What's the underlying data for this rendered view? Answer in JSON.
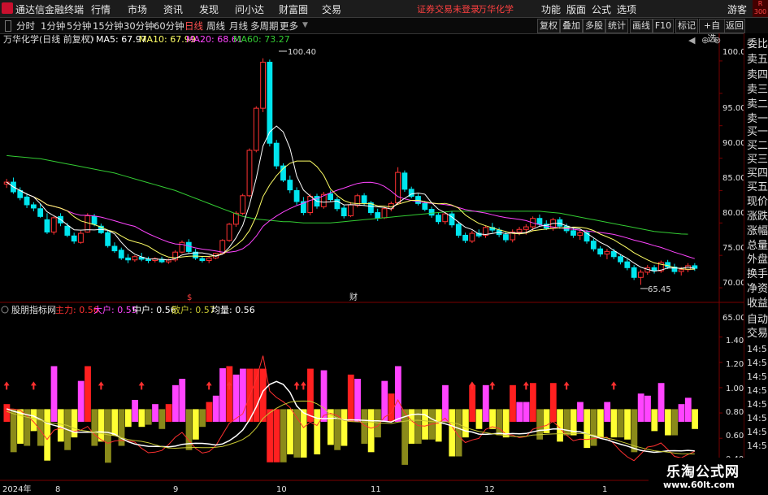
{
  "menubar": {
    "app_title": "通达信金融终端",
    "items": [
      "行情",
      "市场",
      "资讯",
      "发现",
      "问小达",
      "财富圈",
      "交易"
    ],
    "status": "证券交易未登录",
    "stock": "万华化学",
    "right_items": [
      "功能",
      "版面",
      "公式",
      "选项"
    ],
    "guest": "游客"
  },
  "toolbar": {
    "periods": [
      "分时",
      "1分钟",
      "5分钟",
      "15分钟",
      "30分钟",
      "60分钟",
      "日线",
      "周线",
      "月线",
      "多周期",
      "更多"
    ],
    "active": "日线",
    "buttons": [
      "复权",
      "叠加",
      "多股",
      "统计",
      "画线",
      "F10",
      "标记",
      "+自选",
      "返回"
    ]
  },
  "main": {
    "title": "万华化学(日线 前复权)",
    "ma_labels": [
      {
        "text": "MA5: 67.97",
        "color": "#ffffff"
      },
      {
        "text": "MA10: 67.99",
        "color": "#ffff66"
      },
      {
        "text": "MA20: 68.61",
        "color": "#ff44ff"
      },
      {
        "text": "MA60: 73.27",
        "color": "#33cc33"
      }
    ],
    "high_label": "100.40",
    "low_label": "65.45",
    "y_ticks": [
      "100.0",
      "95.00",
      "90.00",
      "85.00",
      "80.00",
      "75.00",
      "70.00",
      "65.00"
    ],
    "markers": [
      "$",
      "财"
    ]
  },
  "sub": {
    "title": "股朋指标网",
    "labels": [
      {
        "text": "主力: 0.56",
        "color": "#ff3030"
      },
      {
        "text": "大户: 0.55",
        "color": "#ff44ff"
      },
      {
        "text": "中户: 0.56",
        "color": "#ffffff"
      },
      {
        "text": "散户: 0.57",
        "color": "#c8c832"
      },
      {
        "text": "均量: 0.56",
        "color": "#ffffff"
      }
    ],
    "y_ticks": [
      "1.40",
      "1.20",
      "1.00",
      "0.80",
      "0.60",
      "0.40"
    ]
  },
  "x_axis": [
    "2024年",
    "8",
    "9",
    "10",
    "11",
    "12",
    "1"
  ],
  "right_panel": [
    "委比",
    "卖五",
    "卖四",
    "卖三",
    "卖二",
    "卖一",
    "买一",
    "买二",
    "买三",
    "买四",
    "买五",
    "现价",
    "涨跌",
    "涨幅",
    "总量",
    "外盘",
    "换手",
    "净资",
    "收益",
    "",
    "自动",
    "交易",
    "14:5",
    "14:5",
    "14:5",
    "14:5",
    "14:5",
    "14:5",
    "14:5",
    "14:5"
  ],
  "watermark": {
    "line1": "乐淘公式网",
    "line2": "www.60lt.com"
  },
  "colors": {
    "up": "#ff3232",
    "down": "#00e5ee",
    "ma5": "#ffffff",
    "ma10": "#ffff66",
    "ma20": "#ff44ff",
    "ma60": "#33cc33",
    "axis": "#7a0000"
  },
  "chart_data": {
    "type": "candlestick",
    "price_ylim": [
      63.5,
      102.5
    ],
    "sub_ylim": [
      0.28,
      1.52
    ],
    "candles": [
      [
        81,
        81.8,
        80.4,
        81.3
      ],
      [
        81.3,
        82,
        79.5,
        79.8
      ],
      [
        80,
        80.5,
        78.5,
        78.9
      ],
      [
        79,
        79.6,
        77.3,
        77.8
      ],
      [
        77.8,
        78.2,
        76.8,
        77.3
      ],
      [
        77.2,
        78,
        75.8,
        76
      ],
      [
        75.5,
        76.5,
        73.3,
        73.6
      ],
      [
        73.6,
        76,
        73.2,
        75.8
      ],
      [
        76,
        76.5,
        74.5,
        75
      ],
      [
        74.5,
        75,
        72.8,
        73.1
      ],
      [
        73,
        73.5,
        71.8,
        72.2
      ],
      [
        72,
        73.8,
        71.8,
        73.4
      ],
      [
        73.6,
        76.5,
        73.5,
        76.1
      ],
      [
        76,
        76.4,
        74.5,
        74.8
      ],
      [
        74.5,
        74.9,
        73.3,
        73.5
      ],
      [
        73.5,
        73.8,
        71.2,
        71.5
      ],
      [
        71.4,
        72,
        70.4,
        70.7
      ],
      [
        70.8,
        71.2,
        69.3,
        69.6
      ],
      [
        69.6,
        70.2,
        68.8,
        69.3
      ],
      [
        69.3,
        70,
        69,
        69.8
      ],
      [
        69.7,
        70.4,
        69.1,
        69.4
      ],
      [
        69.4,
        69.8,
        68.8,
        69.2
      ],
      [
        69.2,
        69.7,
        68.9,
        69.5
      ],
      [
        69.4,
        69.8,
        68.8,
        69
      ],
      [
        69,
        69.5,
        68.7,
        69.3
      ],
      [
        69.3,
        70.8,
        69,
        70.5
      ],
      [
        70.5,
        72.3,
        70.3,
        72
      ],
      [
        72,
        72.5,
        70.3,
        70.6
      ],
      [
        70.5,
        71,
        69.3,
        69.6
      ],
      [
        69.5,
        69.9,
        68.9,
        69.2
      ],
      [
        69.2,
        69.8,
        68.8,
        69.6
      ],
      [
        69.6,
        70.4,
        69.4,
        70.3
      ],
      [
        70.3,
        72.5,
        70.1,
        72.3
      ],
      [
        72.3,
        75,
        72.1,
        74.8
      ],
      [
        74.8,
        76.8,
        74.4,
        76.5
      ],
      [
        76.5,
        79.5,
        76.2,
        79.2
      ],
      [
        79.2,
        86.5,
        79,
        86.2
      ],
      [
        86.2,
        93,
        85.9,
        92.7
      ],
      [
        92.7,
        100.4,
        92.1,
        99.8
      ],
      [
        99.8,
        100.2,
        86.8,
        87.3
      ],
      [
        87.3,
        87.8,
        83.3,
        83.8
      ],
      [
        83.8,
        84.2,
        81.3,
        81.6
      ],
      [
        81.6,
        82.3,
        79.6,
        80.1
      ],
      [
        80,
        80.5,
        77.8,
        78.3
      ],
      [
        78.3,
        79,
        76.2,
        76.6
      ],
      [
        76.6,
        79.5,
        76.2,
        79.1
      ],
      [
        79.1,
        79.5,
        77.2,
        77.6
      ],
      [
        77.5,
        79.8,
        77.2,
        79.4
      ],
      [
        79.5,
        80,
        78.3,
        78.6
      ],
      [
        78.6,
        79,
        76.8,
        77.2
      ],
      [
        77.3,
        77.7,
        75.7,
        76.1
      ],
      [
        76.1,
        78.2,
        75.9,
        77.8
      ],
      [
        77.7,
        79.5,
        77.4,
        79.2
      ],
      [
        79.2,
        79.6,
        77.7,
        78.1
      ],
      [
        78.1,
        78.4,
        76.2,
        76.6
      ],
      [
        76.6,
        77.2,
        75.3,
        75.8
      ],
      [
        75.8,
        77.5,
        75.6,
        77.2
      ],
      [
        77.2,
        78.3,
        76.8,
        78
      ],
      [
        78.1,
        83.6,
        77.8,
        82.8
      ],
      [
        82.7,
        83.1,
        79.8,
        80.2
      ],
      [
        80.2,
        80.6,
        78.8,
        79.1
      ],
      [
        79.1,
        79.5,
        77.7,
        78
      ],
      [
        78,
        78.4,
        76.8,
        77.1
      ],
      [
        77.1,
        77.5,
        75.8,
        76.2
      ],
      [
        76.2,
        76.6,
        74.8,
        75.2
      ],
      [
        75.2,
        76.7,
        74.8,
        76.4
      ],
      [
        76.4,
        76.8,
        74.3,
        74.7
      ],
      [
        74.8,
        75.2,
        72.7,
        73.1
      ],
      [
        73.1,
        73.5,
        71.9,
        72.3
      ],
      [
        72.2,
        73.8,
        71.9,
        73.4
      ],
      [
        73.4,
        74,
        72.7,
        73
      ],
      [
        73.1,
        74.6,
        72.7,
        74.3
      ],
      [
        74.3,
        75,
        73.5,
        73.9
      ],
      [
        73.9,
        74.3,
        72.8,
        73.2
      ],
      [
        73.2,
        73.6,
        72,
        72.4
      ],
      [
        72.4,
        74,
        72,
        73.6
      ],
      [
        73.6,
        74.4,
        73.1,
        74
      ],
      [
        74,
        74.8,
        73.2,
        74.4
      ],
      [
        74.4,
        76,
        73.8,
        75.7
      ],
      [
        75.7,
        76.3,
        74.4,
        74.8
      ],
      [
        74.8,
        75.4,
        73.9,
        74.2
      ],
      [
        74.2,
        75.8,
        73.8,
        75.5
      ],
      [
        75.5,
        75.9,
        74.1,
        74.5
      ],
      [
        74.5,
        74.9,
        73.4,
        73.8
      ],
      [
        73.8,
        74.3,
        72.7,
        73.1
      ],
      [
        73.1,
        74,
        72.4,
        73.5
      ],
      [
        73.5,
        73.9,
        71.8,
        72.2
      ],
      [
        72.2,
        72.6,
        70.6,
        71
      ],
      [
        71,
        71.4,
        69.8,
        70.2
      ],
      [
        70.2,
        71,
        69.4,
        70.6
      ],
      [
        70.6,
        71,
        69.4,
        69.8
      ],
      [
        69.8,
        70.2,
        68.6,
        69
      ],
      [
        69,
        69.4,
        67.7,
        68.1
      ],
      [
        68.1,
        68.5,
        66.2,
        66.6
      ],
      [
        66.6,
        67.8,
        65.45,
        67.4
      ],
      [
        67.4,
        68.5,
        67,
        68.1
      ],
      [
        68.1,
        68.5,
        67.2,
        67.6
      ],
      [
        67.6,
        69.2,
        67.3,
        68.9
      ],
      [
        68.9,
        69.3,
        67.9,
        68.2
      ],
      [
        68.2,
        68.7,
        67.1,
        67.5
      ],
      [
        67.5,
        68.2,
        66.9,
        67.8
      ],
      [
        67.8,
        68.8,
        67.4,
        68.4
      ],
      [
        68.4,
        68.8,
        67.6,
        68
      ]
    ],
    "ma60": [
      85.4,
      85.3,
      85.2,
      85.1,
      85,
      84.9,
      84.7,
      84.5,
      84.3,
      84.1,
      83.9,
      83.7,
      83.5,
      83.3,
      83.1,
      82.9,
      82.7,
      82.4,
      82.1,
      81.8,
      81.5,
      81.2,
      80.9,
      80.6,
      80.3,
      80,
      79.6,
      79.2,
      78.8,
      78.4,
      78,
      77.6,
      77.2,
      76.8,
      76.4,
      76,
      75.8,
      75.6,
      75.5,
      75.4,
      75.3,
      75.2,
      75.2,
      75.1,
      75,
      75,
      75,
      75,
      75,
      75.1,
      75.2,
      75.3,
      75.4,
      75.5,
      75.6,
      75.7,
      75.8,
      75.9,
      76,
      76.1,
      76.2,
      76.3,
      76.4,
      76.5,
      76.6,
      76.7,
      76.8,
      76.8,
      76.8,
      76.8,
      76.8,
      76.8,
      76.8,
      76.8,
      76.8,
      76.8,
      76.8,
      76.8,
      76.8,
      76.8,
      76.7,
      76.6,
      76.5,
      76.3,
      76.1,
      75.9,
      75.7,
      75.5,
      75.3,
      75.1,
      74.9,
      74.7,
      74.5,
      74.3,
      74.1,
      73.9,
      73.7,
      73.6,
      73.5,
      73.4,
      73.3,
      73.27
    ],
    "sub_arrows": [
      0,
      4,
      14,
      20,
      30,
      33,
      43,
      44,
      69,
      72,
      77,
      83,
      90
    ],
    "sub_bars_note": "multi-color volume-style blocks around 0.78 baseline"
  }
}
